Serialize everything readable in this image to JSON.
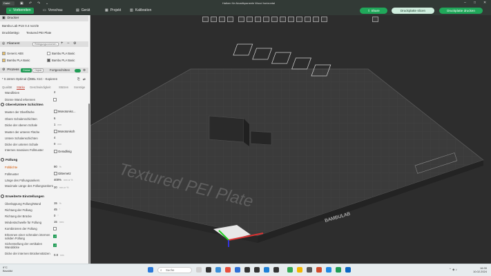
{
  "titlebar": {
    "file_menu": "Datei",
    "window_title": "Halken für Akustikpaneele Wood horizontal"
  },
  "tabs": [
    {
      "label": "Vorbereiten",
      "icon": "prepare-icon",
      "active": true
    },
    {
      "label": "Vorschau",
      "icon": "preview-icon",
      "active": false
    },
    {
      "label": "Gerät",
      "icon": "device-icon",
      "active": false
    },
    {
      "label": "Projekt",
      "icon": "project-icon",
      "active": false
    },
    {
      "label": "Kalibration",
      "icon": "calibration-icon",
      "active": false
    }
  ],
  "actions": {
    "share": "Share",
    "slice": "Druckplatte slicen",
    "print": "Druckplatte drucken"
  },
  "printer": {
    "header": "Drucker",
    "name": "Bambu Lab P1S 0.4 nozzle",
    "bed_label": "Druckbetttyp",
    "bed_value": "Textured PEI Plate"
  },
  "filament": {
    "header": "Filament",
    "button": "Reinigungsvolumen",
    "items": [
      {
        "index": "1",
        "name": "Generic ABS",
        "color": "#e8c06a"
      },
      {
        "index": "2",
        "name": "Bambu PLA Basic",
        "color": "#ffffff"
      },
      {
        "index": "3",
        "name": "Bambu PLA Basic",
        "color": "#e8c06a"
      },
      {
        "index": "4",
        "name": "Bambu PLA Basic",
        "color": "#555555"
      }
    ]
  },
  "process": {
    "header": "Prozess",
    "toggle_global": "Global",
    "toggle_object": "Objekt",
    "advanced_label": "Fortgeschritten",
    "preset": "* 0.16mm Optimal @BBL X1C - Kopieren",
    "subtabs": [
      "Qualität",
      "Stärke",
      "Geschwindigkeit",
      "Stützen",
      "Sonstige"
    ]
  },
  "settings": {
    "wall_loops_label": "Wandlinien",
    "wall_loops_value": "2",
    "thin_wall_label": "Dünne Wand erkennen",
    "top_bottom": {
      "title": "Obere/Untere Schichten",
      "rows": [
        {
          "label": "Muster der Oberfläche",
          "value": "Monotonisc...",
          "unit": ""
        },
        {
          "label": "Obere Schalenschichten",
          "value": "6",
          "unit": ""
        },
        {
          "label": "Dicke der oberen Schale",
          "value": "1",
          "unit": "mm"
        },
        {
          "label": "Muster der unteren Fläche",
          "value": "Monotonisch",
          "unit": ""
        },
        {
          "label": "Untere Schalenschichten",
          "value": "4",
          "unit": ""
        },
        {
          "label": "Dicke der unteren Schale",
          "value": "0",
          "unit": "mm"
        },
        {
          "label": "Internes massives Füllmuster",
          "value": "Geradlinig",
          "unit": ""
        }
      ]
    },
    "infill": {
      "title": "Füllung",
      "rows": [
        {
          "label": "Fülldichte",
          "value": "90",
          "unit": "%"
        },
        {
          "label": "Füllmuster",
          "value": "Gitternetz",
          "unit": ""
        },
        {
          "label": "Länge des Füllungsankers",
          "value": "400%",
          "unit": "mm or %"
        },
        {
          "label": "Maximale Länge des Füllungsankers",
          "value": "20",
          "unit": "mm or %"
        }
      ]
    },
    "advanced": {
      "title": "Erweiterte Einstellungen",
      "rows": [
        {
          "label": "Überlappung Füllung/Wand",
          "value": "15",
          "unit": "%"
        },
        {
          "label": "Richtung der Füllung",
          "value": "45",
          "unit": "°"
        },
        {
          "label": "Richtung der Brücke",
          "value": "0",
          "unit": "°"
        },
        {
          "label": "Mindestschwelle für Füllung",
          "value": "15",
          "unit": "mm²"
        },
        {
          "label": "Kombinieren der Füllung",
          "value": "",
          "unit": ""
        },
        {
          "label": "Erkennen einer schmalen internen soliden Füllung",
          "value": "",
          "unit": ""
        },
        {
          "label": "Sicherstellung der vertikalen Wanddicke",
          "value": "",
          "unit": ""
        },
        {
          "label": "Dicke der internen Brückenstützen",
          "value": "0.8",
          "unit": "mm"
        }
      ]
    }
  },
  "plate": {
    "text": "Textured PEI Plate",
    "brand": "BAMBULAB"
  },
  "taskbar": {
    "temperature": "9°C",
    "weather": "Bewölkt",
    "search": "Suche",
    "time": "16:39",
    "date": "10.02.2024"
  }
}
